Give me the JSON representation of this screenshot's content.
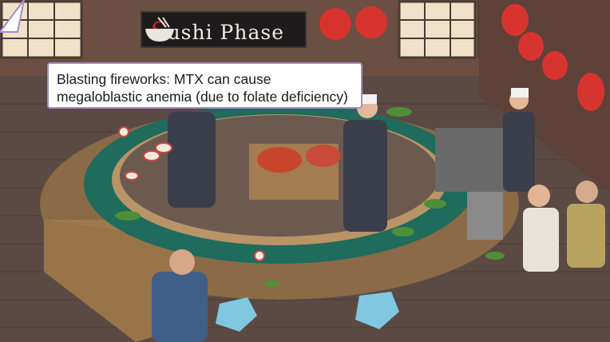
{
  "game": {
    "sign": {
      "first_letter": "S",
      "rest": "ushi Phase"
    },
    "tooltip": {
      "text": "Blasting fireworks: MTX can cause megaloblastic anemia (due to folate deficiency)"
    }
  },
  "colors": {
    "wall": "#6b4f43",
    "floor": "#5b4a44",
    "belt": "#1f6b5c",
    "counter": "#a07a4e",
    "lantern": "#d8342f",
    "tooltip_border": "#a68cc8"
  }
}
